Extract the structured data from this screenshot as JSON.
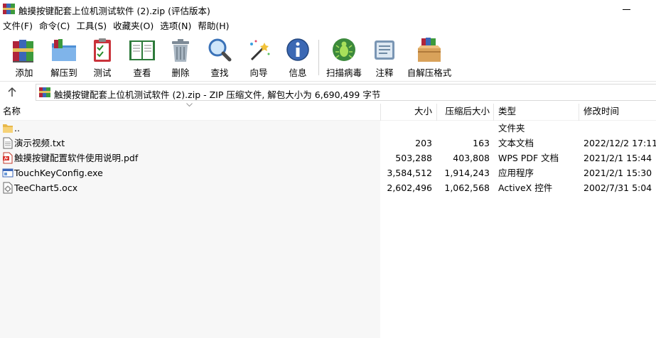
{
  "window": {
    "title": "触摸按键配套上位机测试软件 (2).zip (评估版本)"
  },
  "menu": [
    "文件(F)",
    "命令(C)",
    "工具(S)",
    "收藏夹(O)",
    "选项(N)",
    "帮助(H)"
  ],
  "toolbar": [
    {
      "label": "添加",
      "icon": "add-books-icon"
    },
    {
      "label": "解压到",
      "icon": "extract-folder-icon"
    },
    {
      "label": "测试",
      "icon": "test-clipboard-icon"
    },
    {
      "label": "查看",
      "icon": "view-book-icon"
    },
    {
      "label": "删除",
      "icon": "trash-icon"
    },
    {
      "label": "查找",
      "icon": "magnifier-icon"
    },
    {
      "label": "向导",
      "icon": "wizard-wand-icon"
    },
    {
      "label": "信息",
      "icon": "info-icon"
    },
    {
      "label": "扫描病毒",
      "icon": "virus-scan-icon"
    },
    {
      "label": "注释",
      "icon": "comment-icon"
    },
    {
      "label": "自解压格式",
      "icon": "sfx-box-icon"
    }
  ],
  "address": {
    "text": "触摸按键配套上位机测试软件 (2).zip - ZIP 压缩文件, 解包大小为 6,690,499 字节"
  },
  "columns": {
    "name": "名称",
    "size": "大小",
    "packed": "压缩后大小",
    "type": "类型",
    "modified": "修改时间"
  },
  "files": [
    {
      "name": "..",
      "size": "",
      "packed": "",
      "type": "文件夹",
      "modified": "",
      "icon": "folder-icon"
    },
    {
      "name": "演示视频.txt",
      "size": "203",
      "packed": "163",
      "type": "文本文档",
      "modified": "2022/12/2 17:11",
      "icon": "text-file-icon"
    },
    {
      "name": "触摸按键配置软件使用说明.pdf",
      "size": "503,288",
      "packed": "403,808",
      "type": "WPS PDF 文档",
      "modified": "2021/2/1 15:44",
      "icon": "pdf-file-icon"
    },
    {
      "name": "TouchKeyConfig.exe",
      "size": "3,584,512",
      "packed": "1,914,243",
      "type": "应用程序",
      "modified": "2021/2/1 15:30",
      "icon": "exe-file-icon"
    },
    {
      "name": "TeeChart5.ocx",
      "size": "2,602,496",
      "packed": "1,062,568",
      "type": "ActiveX 控件",
      "modified": "2002/7/31 5:04",
      "icon": "ocx-file-icon"
    }
  ]
}
